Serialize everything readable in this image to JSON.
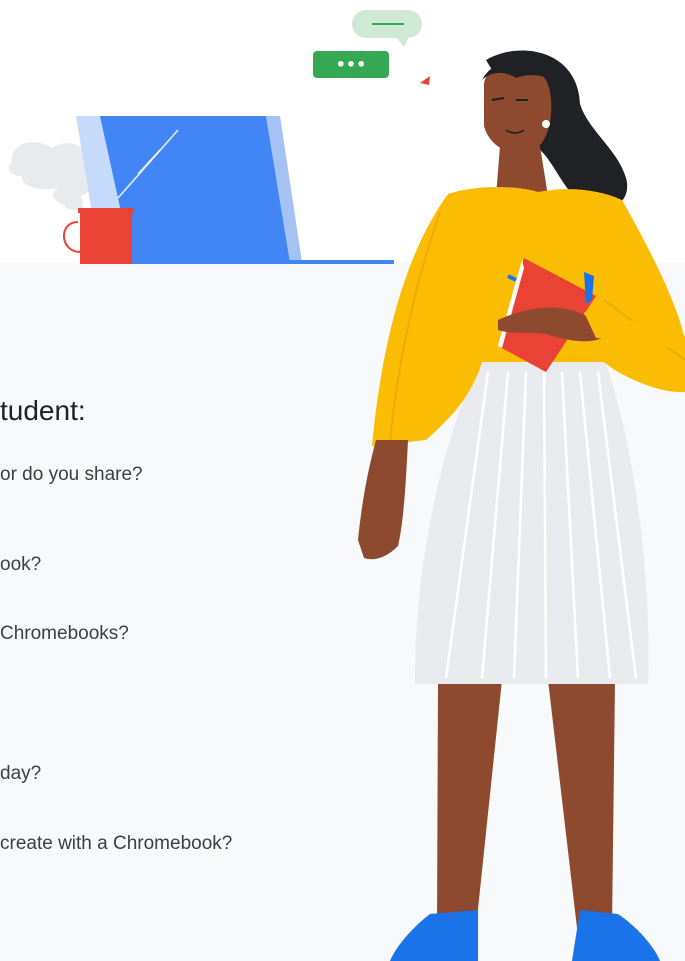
{
  "section": {
    "heading": "tudent:",
    "questions": [
      "or do you share?",
      "ook?",
      " Chromebooks?",
      "day?",
      "create with a Chromebook?"
    ]
  },
  "illustration": {
    "chat_bubble_text": "•••",
    "colors": {
      "laptop_screen": "#4285f4",
      "laptop_screen_edge": "#a4c2f4",
      "mug": "#ea4335",
      "sweater": "#fbbc04",
      "skirt": "#e8eaed",
      "skin": "#8d4a2f",
      "hair": "#202124",
      "shoes": "#1a73e8",
      "book": "#ea4335",
      "chat_bubble": "#34a853",
      "panel_background": "#f8f9fa"
    }
  }
}
